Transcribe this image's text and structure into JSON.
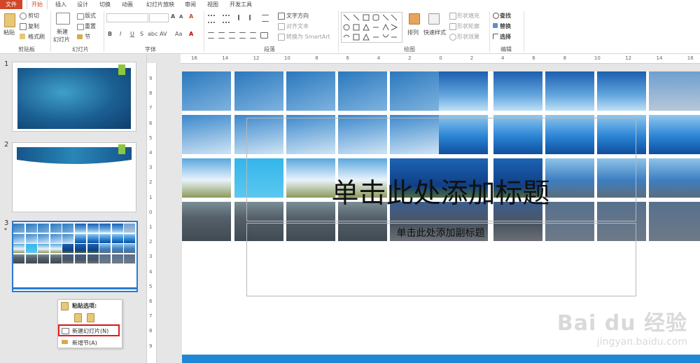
{
  "tabs": {
    "file": "文件",
    "home": "开始",
    "insert": "插入",
    "design": "设计",
    "transitions": "切换",
    "animations": "动画",
    "slideshow": "幻灯片放映",
    "review": "审阅",
    "view": "视图",
    "developer": "开发工具"
  },
  "ribbon": {
    "clipboard": {
      "label": "剪贴板",
      "paste": "粘贴",
      "cut": "剪切",
      "copy": "复制",
      "format_painter": "格式刷"
    },
    "slides": {
      "label": "幻灯片",
      "new_slide_line1": "新建",
      "new_slide_line2": "幻灯片",
      "layout": "版式",
      "reset": "重置",
      "section": "节"
    },
    "font": {
      "label": "字体",
      "bold": "B",
      "italic": "I",
      "underline": "U",
      "strike": "S",
      "shadow": "abc",
      "spacing": "AV",
      "case": "Aa",
      "clear": "A"
    },
    "paragraph": {
      "label": "段落",
      "text_direction": "文字方向",
      "align_text": "对齐文本",
      "smartart": "转换为 SmartArt"
    },
    "drawing": {
      "label": "绘图",
      "arrange": "排列",
      "quick_styles": "快速样式",
      "shape_fill": "形状填充",
      "shape_outline": "形状轮廓",
      "shape_effects": "形状效果"
    },
    "editing": {
      "label": "编辑",
      "find": "查找",
      "replace": "替换",
      "select": "选择"
    }
  },
  "slides_panel": {
    "slide1_num": "1",
    "slide2_num": "2",
    "slide3_num": "3",
    "slide3_star": "*",
    "accent_color": "#8dc63f"
  },
  "context_menu": {
    "paste_options": "粘贴选项:",
    "new_slide": "新建幻灯片(N)",
    "new_section": "新增节(A)"
  },
  "hruler_labels": [
    "16",
    "14",
    "12",
    "10",
    "8",
    "6",
    "4",
    "2",
    "0",
    "2",
    "4",
    "6",
    "8",
    "10",
    "12",
    "14",
    "16"
  ],
  "vruler_labels": [
    "9",
    "8",
    "7",
    "6",
    "5",
    "4",
    "3",
    "2",
    "1",
    "0",
    "1",
    "2",
    "3",
    "4",
    "5",
    "6",
    "7",
    "8",
    "9"
  ],
  "slide": {
    "title_placeholder": "单击此处添加标题",
    "subtitle_placeholder": "单击此处添加副标题"
  },
  "watermark": {
    "brand": "Bai du 经验",
    "url": "jingyan.baidu.com"
  }
}
